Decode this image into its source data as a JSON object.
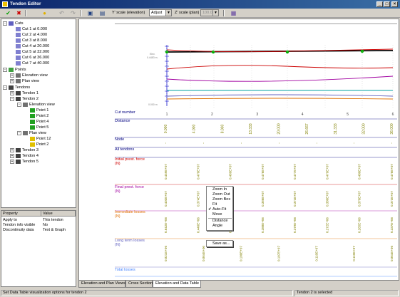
{
  "window": {
    "title": "Tendon Editor",
    "min": "_",
    "max": "□",
    "close": "×"
  },
  "toolbar": {
    "ok_icon": "check-icon",
    "cancel_icon": "x-icon",
    "help_icon": "bulb-icon",
    "y_scale_label": "Y' scale (elevation)",
    "y_scale_value": "Adjust",
    "z_scale_label": "Z' scale (plan)",
    "z_scale_value": "100.0"
  },
  "tree": {
    "cuts_label": "Cuts",
    "cuts": [
      "Cut 1 at 0.000",
      "Cut 2 at 4.000",
      "Cut 3 at 8.000",
      "Cut 4 at 20.000",
      "Cut 5 at 32.000",
      "Cut 6 at 36.000",
      "Cut 7 at 40.000"
    ],
    "points_label": "Points",
    "elevation_view": "Elevation view",
    "plan_view": "Plan view",
    "tendons_label": "Tendons",
    "tendon1": "Tendon 1",
    "tendon2": "Tendon 2",
    "t2_elev_points": [
      "Point 1",
      "Point 2",
      "Point 4",
      "Point 5"
    ],
    "t2_plan_points": [
      "Point 12",
      "Point 2"
    ],
    "tendon3": "Tendon 3",
    "tendon4": "Tendon 4",
    "tendon5": "Tendon 5"
  },
  "properties": {
    "col_property": "Property",
    "col_value": "Value",
    "rows": [
      [
        "Apply to",
        "This tendon"
      ],
      [
        "Tendon info visible",
        "No"
      ],
      [
        "Discontinuity data",
        "Text & Graph"
      ]
    ]
  },
  "graph": {
    "colors": {
      "accent": "#0000cc",
      "green": "#00b000",
      "red": "#cc0000",
      "olive": "#808000",
      "purple": "#a000a0",
      "orange": "#e07000"
    },
    "y_axis_top": "Elev.",
    "y_axis_top2": "0.4483 m.",
    "y_axis_bottom": "0.000 m"
  },
  "table": {
    "rows": [
      {
        "label": "Cut number",
        "color": "#000080",
        "values": [
          "1",
          "2",
          "3",
          "4",
          "5",
          "6"
        ]
      },
      {
        "label": "Distance",
        "color": "#000080",
        "values": [
          "0.000",
          "4.000",
          "8.000",
          "13.333",
          "20.000",
          "26.667",
          "31.333",
          "32.000",
          "36.000"
        ]
      },
      {
        "label": "Node",
        "color": "#000080",
        "values": [
          "-",
          "-",
          "-",
          "-",
          "-",
          "-",
          "-"
        ]
      },
      {
        "label": "All tendons",
        "color": "#000080",
        "values": []
      },
      {
        "label": "Initial prest. force",
        "label2": "(N)",
        "color": "#cc0000",
        "values": [
          "0.459E+07",
          "0.470E+07",
          "0.489E+07",
          "0.476E+07",
          "0.477E+07",
          "0.479E+07",
          "0.480E+07",
          "0.476E+07"
        ]
      },
      {
        "label": "Final prest. force",
        "label2": "(N)",
        "color": "#a000a0",
        "values": [
          "0.403E+07",
          "0.374E+07",
          "0.387E+07",
          "0.386E+07",
          "0.374E+07",
          "0.380E+07",
          "0.370E+07",
          "0.373E+07"
        ]
      },
      {
        "label": "Immediate losses",
        "label2": "(N)",
        "color": "#e07000",
        "values": [
          "0.642E+06",
          "0.440E+06",
          "0.274E+06",
          "0.388E+06",
          "0.379E+06",
          "0.272E+06",
          "0.265E+06",
          "0.337E+06"
        ]
      },
      {
        "label": "Long term losses",
        "label2": "(N)",
        "color": "#6060c0",
        "values": [
          "0.821E+06",
          "0.864E+06",
          "0.100E+07",
          "0.107E+07",
          "0.110E+07",
          "0.110E+07",
          "0.864E+06"
        ]
      },
      {
        "label": "Total losses",
        "color": "#4080ff",
        "values": []
      }
    ]
  },
  "context_menu": {
    "items": [
      "Zoom In",
      "Zoom Out",
      "Zoom Box",
      "Fit",
      "Auto-Fit",
      "Move",
      "Distance",
      "Angle",
      "Save as..."
    ],
    "checked": "Auto-Fit"
  },
  "tabs": [
    "Elevation and Plan Views",
    "Cross Section",
    "Elevation and Data Table"
  ],
  "status": {
    "left": "Set Data Table visualization options for tendon 2",
    "right": "Tendon 2 is selected"
  }
}
